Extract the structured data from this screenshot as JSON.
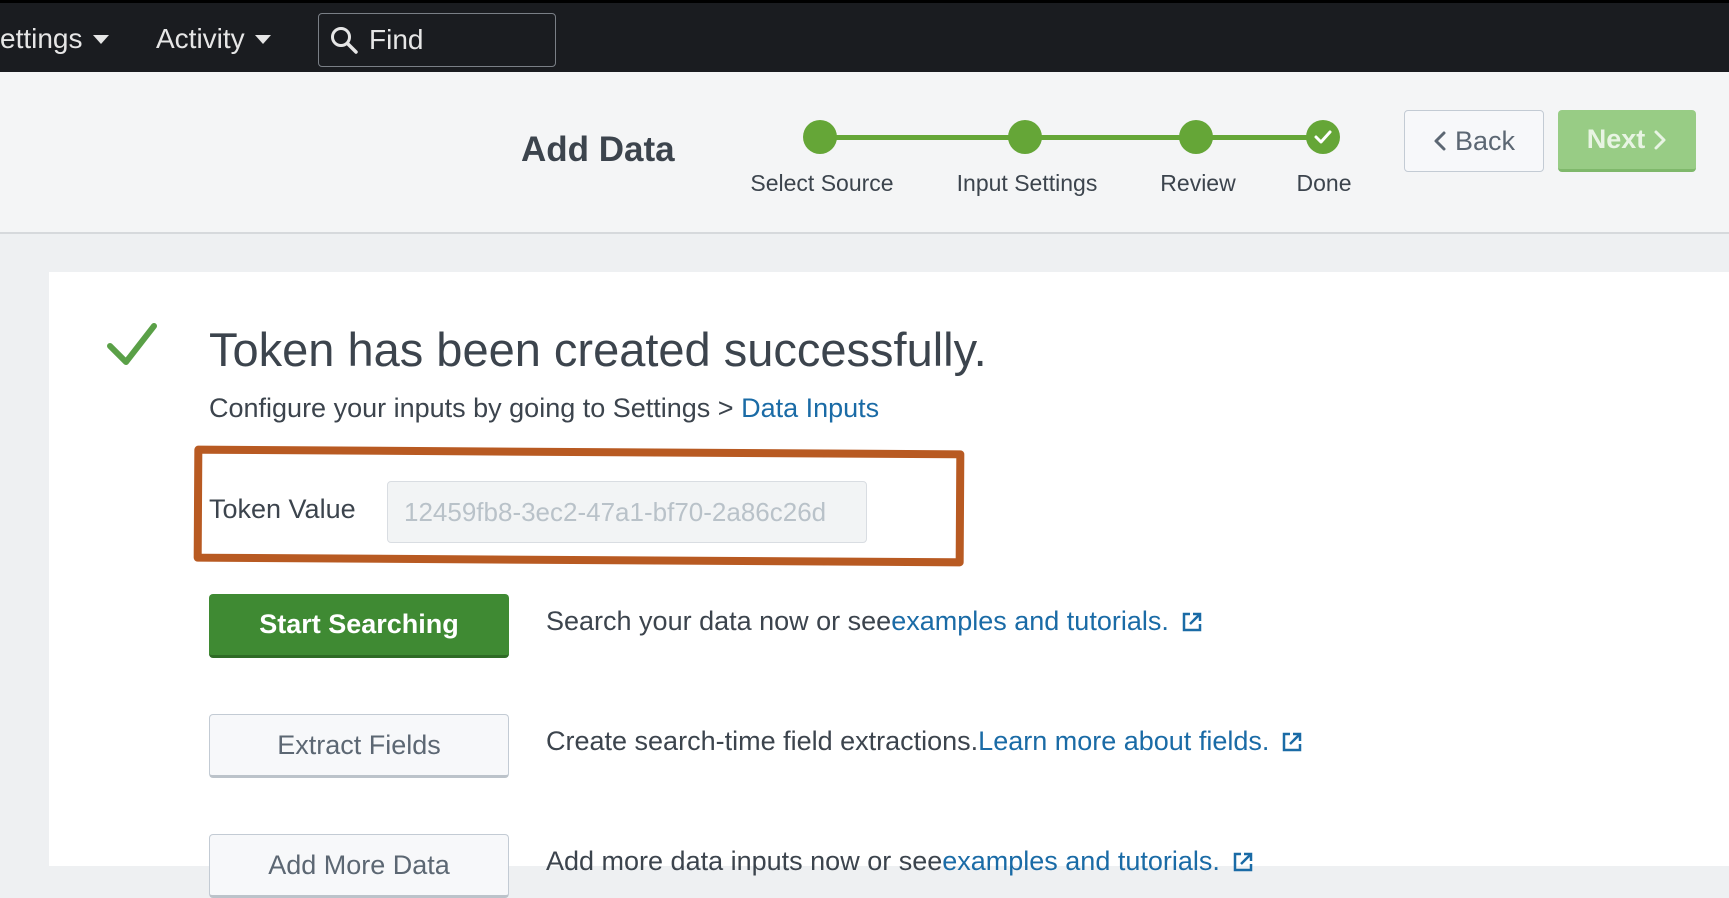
{
  "topbar": {
    "settings_label": "ettings",
    "activity_label": "Activity",
    "find_placeholder": "Find"
  },
  "header": {
    "title": "Add Data",
    "steps": [
      {
        "label": "Select Source"
      },
      {
        "label": "Input Settings"
      },
      {
        "label": "Review"
      },
      {
        "label": "Done"
      }
    ],
    "back_label": "Back",
    "next_label": "Next"
  },
  "content": {
    "success_title": "Token has been created successfully.",
    "configure_text": "Configure your inputs by going to Settings > ",
    "configure_link": "Data Inputs",
    "token_label": "Token Value",
    "token_value": "12459fb8-3ec2-47a1-bf70-2a86c26d",
    "actions": [
      {
        "button": "Start Searching",
        "text": "Search your data now or see ",
        "link": "examples and tutorials."
      },
      {
        "button": "Extract Fields",
        "text": "Create search-time field extractions. ",
        "link": "Learn more about fields."
      },
      {
        "button": "Add More Data",
        "text": "Add more data inputs now or see ",
        "link": "examples and tutorials."
      }
    ]
  },
  "colors": {
    "accent_green": "#65a637",
    "button_green": "#3f8a33",
    "link_blue": "#1a6ba6",
    "highlight_orange": "#b85a22"
  }
}
